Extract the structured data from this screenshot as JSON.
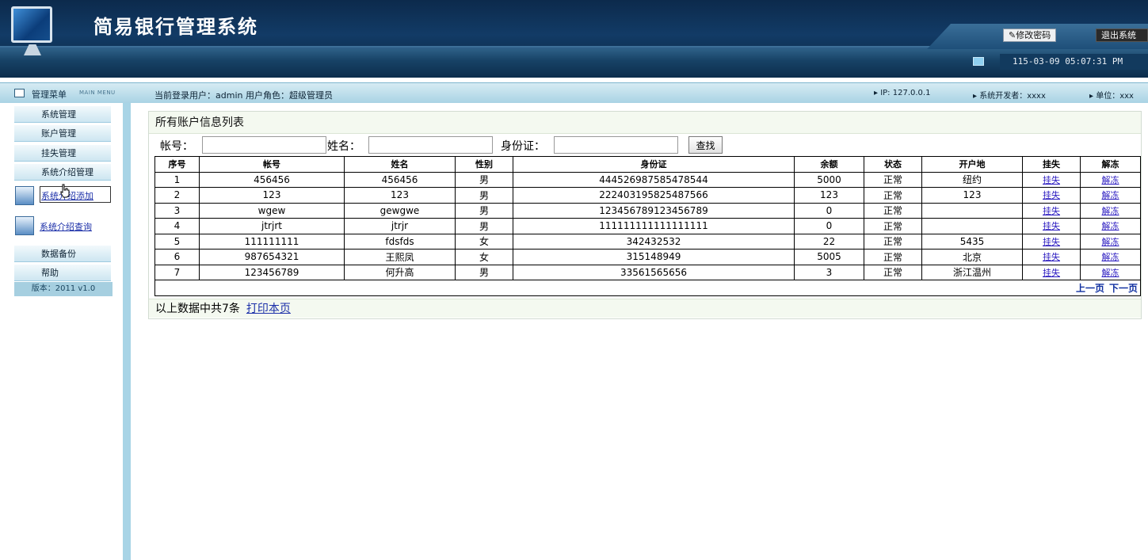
{
  "header": {
    "title": "简易银行管理系统",
    "change_password": "修改密码",
    "logout": "退出系统",
    "clock": "115-03-09 05:07:31 PM"
  },
  "infobar": {
    "menu_label": "管理菜单",
    "menu_sub": "MAIN MENU",
    "user_info": "当前登录用户：admin  用户角色：超级管理员",
    "ip": "▸ IP: 127.0.0.1",
    "developer": "▸ 系统开发者：xxxx",
    "unit": "▸ 单位：xxx"
  },
  "sidebar": {
    "items": [
      "系统管理",
      "账户管理",
      "挂失管理",
      "系统介绍管理"
    ],
    "sub_items": [
      "系统介绍添加",
      "系统介绍查询"
    ],
    "items_bottom": [
      "数据备份",
      "帮助"
    ],
    "version": "版本：2011  v1.0"
  },
  "main": {
    "title": "所有账户信息列表",
    "search": {
      "account_label": "帐号：",
      "name_label": "姓名：",
      "id_label": "身份证：",
      "button": "查找"
    },
    "columns": [
      "序号",
      "帐号",
      "姓名",
      "性别",
      "身份证",
      "余额",
      "状态",
      "开户地",
      "挂失",
      "解冻"
    ],
    "rows": [
      {
        "no": "1",
        "account": "456456",
        "name": "456456",
        "gender": "男",
        "id": "444526987585478544",
        "balance": "5000",
        "status": "正常",
        "location": "纽约",
        "lost": "挂失",
        "unfreeze": "解冻"
      },
      {
        "no": "2",
        "account": "123",
        "name": "123",
        "gender": "男",
        "id": "222403195825487566",
        "balance": "123",
        "status": "正常",
        "location": "123",
        "lost": "挂失",
        "unfreeze": "解冻"
      },
      {
        "no": "3",
        "account": "wgew",
        "name": "gewgwe",
        "gender": "男",
        "id": "123456789123456789",
        "balance": "0",
        "status": "正常",
        "location": "",
        "lost": "挂失",
        "unfreeze": "解冻"
      },
      {
        "no": "4",
        "account": "jtrjrt",
        "name": "jtrjr",
        "gender": "男",
        "id": "111111111111111111",
        "balance": "0",
        "status": "正常",
        "location": "",
        "lost": "挂失",
        "unfreeze": "解冻"
      },
      {
        "no": "5",
        "account": "111111111",
        "name": "fdsfds",
        "gender": "女",
        "id": "342432532",
        "balance": "22",
        "status": "正常",
        "location": "5435",
        "lost": "挂失",
        "unfreeze": "解冻"
      },
      {
        "no": "6",
        "account": "987654321",
        "name": "王熙凤",
        "gender": "女",
        "id": "315148949",
        "balance": "5005",
        "status": "正常",
        "location": "北京",
        "lost": "挂失",
        "unfreeze": "解冻"
      },
      {
        "no": "7",
        "account": "123456789",
        "name": "何升高",
        "gender": "男",
        "id": "33561565656",
        "balance": "3",
        "status": "正常",
        "location": "浙江温州",
        "lost": "挂失",
        "unfreeze": "解冻"
      }
    ],
    "pager": {
      "prev": "上一页",
      "next": "下一页"
    },
    "footer_text": "以上数据中共7条",
    "print_link": "打印本页"
  }
}
